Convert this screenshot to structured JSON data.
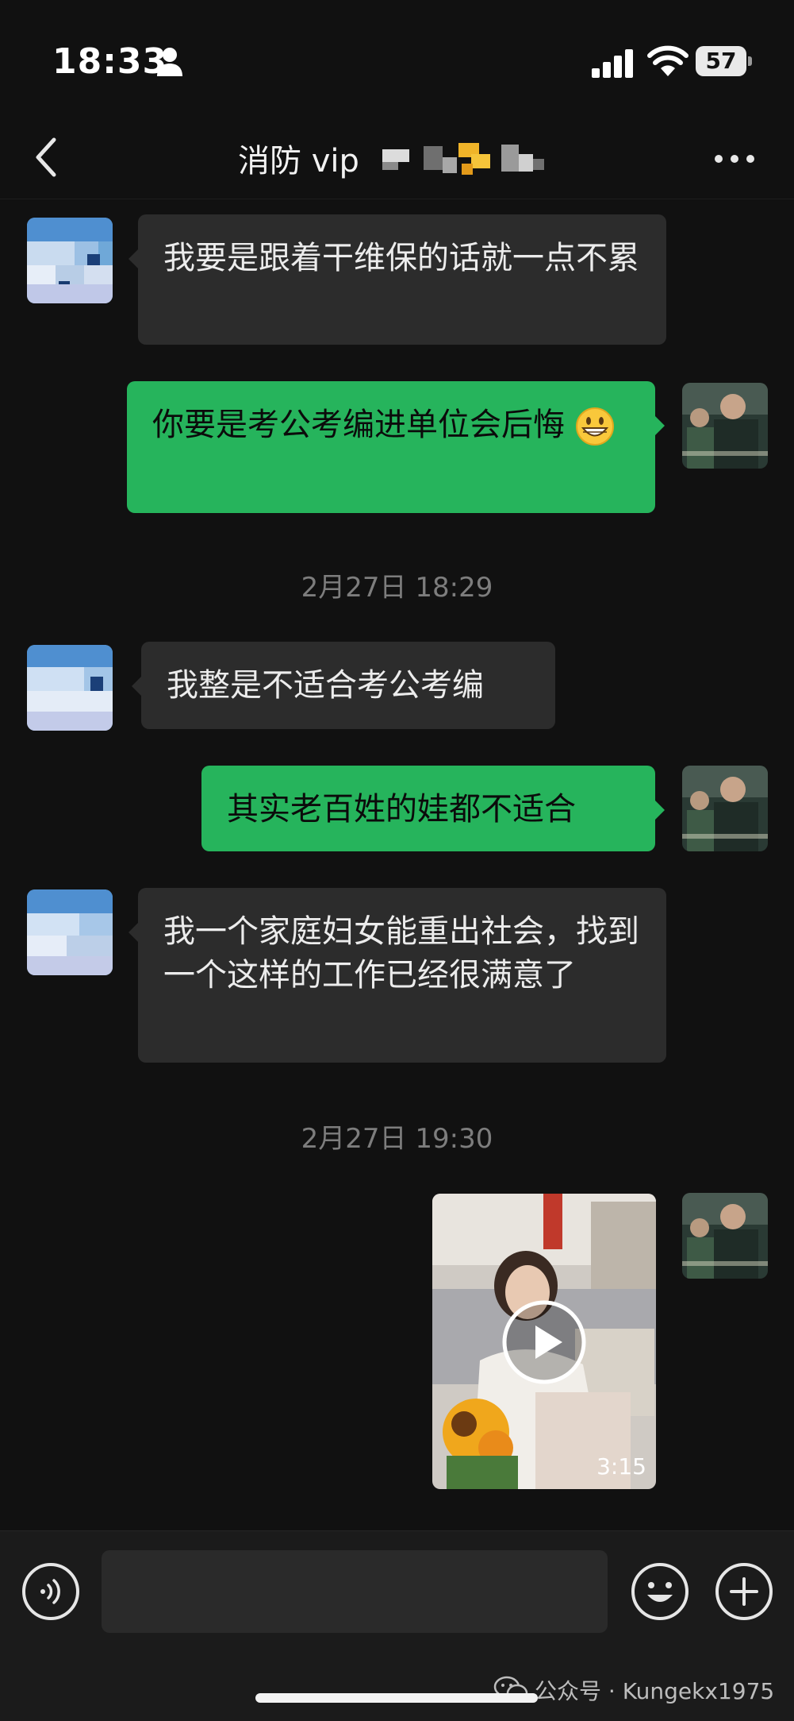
{
  "status_bar": {
    "time": "18:33",
    "battery_level": "57"
  },
  "header": {
    "title": "消防 vip"
  },
  "messages": [
    {
      "id": "m1",
      "side": "incoming",
      "text": "我要是跟着干维保的话就一点不累"
    },
    {
      "id": "m2",
      "side": "outgoing",
      "text": "你要是考公考编进单位会后悔",
      "emoji": "grinning-face-emoji"
    },
    {
      "id": "t1",
      "type": "timestamp",
      "text": "2月27日 18:29"
    },
    {
      "id": "m3",
      "side": "incoming",
      "text": "我整是不适合考公考编"
    },
    {
      "id": "m4",
      "side": "outgoing",
      "text": "其实老百姓的娃都不适合"
    },
    {
      "id": "m5",
      "side": "incoming",
      "text": "我一个家庭妇女能重出社会，找到一个这样的工作已经很满意了"
    },
    {
      "id": "t2",
      "type": "timestamp",
      "text": "2月27日 19:30"
    },
    {
      "id": "m6",
      "side": "outgoing",
      "type": "video",
      "duration": "3:15"
    }
  ],
  "input_bar": {
    "placeholder": "",
    "icons": [
      "voice-icon",
      "emoji-icon",
      "plus-icon"
    ]
  },
  "watermark": {
    "text": "公众号 · Kungekx1975"
  },
  "colors": {
    "background": "#111111",
    "incoming_bubble": "#2c2c2c",
    "outgoing_bubble": "#26b45c",
    "timestamp": "#7d7d7d"
  }
}
